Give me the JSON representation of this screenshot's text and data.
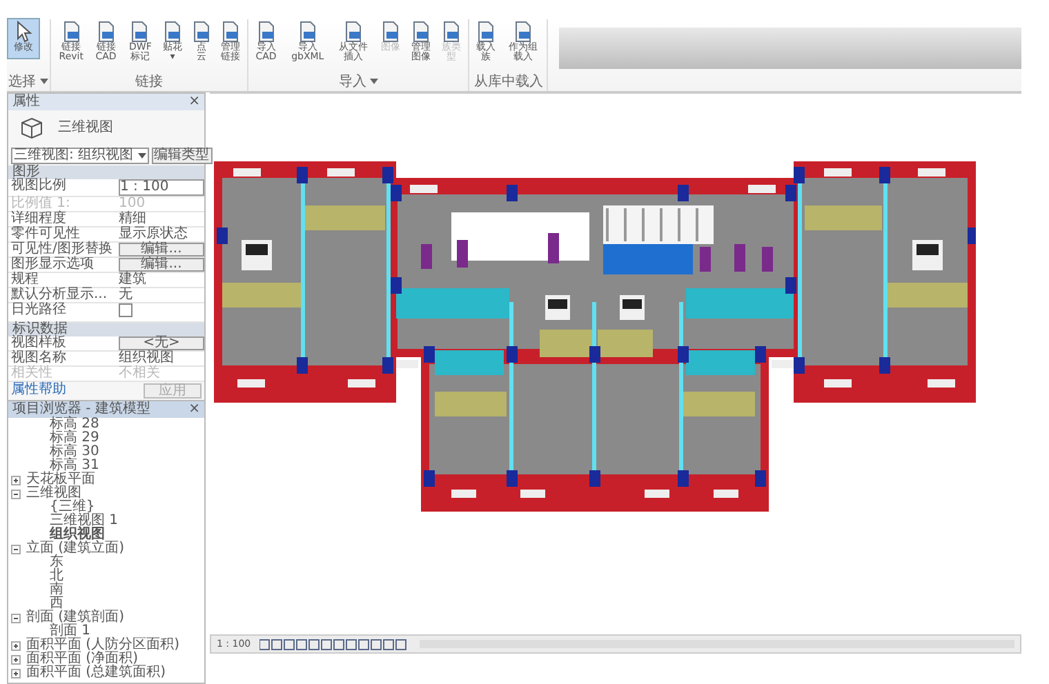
{
  "ribbon": {
    "panels": [
      {
        "title": "选择",
        "dropdown": true,
        "buttons": [
          {
            "kind": "pointer",
            "lines": [
              "修改"
            ],
            "selected": true,
            "disabled": false
          }
        ]
      },
      {
        "title": "链接",
        "dropdown": false,
        "buttons": [
          {
            "kind": "document",
            "lines": [
              "链接",
              "Revit"
            ],
            "selected": false,
            "disabled": false
          },
          {
            "kind": "document",
            "lines": [
              "链接",
              "CAD"
            ],
            "selected": false,
            "disabled": false
          },
          {
            "kind": "document",
            "lines": [
              "DWF",
              "标记"
            ],
            "selected": false,
            "disabled": false
          },
          {
            "kind": "document",
            "lines": [
              "贴花",
              "▾"
            ],
            "selected": false,
            "disabled": false
          },
          {
            "kind": "document",
            "lines": [
              "点",
              "云"
            ],
            "selected": false,
            "disabled": false
          },
          {
            "kind": "document",
            "lines": [
              "管理",
              "链接"
            ],
            "selected": false,
            "disabled": false
          }
        ]
      },
      {
        "title": "导入",
        "dropdown": true,
        "buttons": [
          {
            "kind": "document",
            "lines": [
              "导入",
              "CAD"
            ],
            "selected": false,
            "disabled": false
          },
          {
            "kind": "document",
            "lines": [
              "导入",
              "gbXML"
            ],
            "selected": false,
            "disabled": false
          },
          {
            "kind": "document",
            "lines": [
              "从文件",
              "插入"
            ],
            "selected": false,
            "disabled": false
          },
          {
            "kind": "document",
            "lines": [
              "图像"
            ],
            "selected": false,
            "disabled": true
          },
          {
            "kind": "document",
            "lines": [
              "管理",
              "图像"
            ],
            "selected": false,
            "disabled": false
          },
          {
            "kind": "document",
            "lines": [
              "族类",
              "型"
            ],
            "selected": false,
            "disabled": true
          }
        ]
      },
      {
        "title": "从库中载入",
        "dropdown": false,
        "buttons": [
          {
            "kind": "document",
            "lines": [
              "载入",
              "族"
            ],
            "selected": false,
            "disabled": false
          },
          {
            "kind": "document",
            "lines": [
              "作为组",
              "载入"
            ],
            "selected": false,
            "disabled": false
          }
        ]
      }
    ]
  },
  "properties": {
    "title": "属性",
    "close": "×",
    "type_name": "三维视图",
    "type_selector": "三维视图: 组织视图",
    "edit_type": "编辑类型",
    "groups": [
      {
        "title": "图形",
        "rows": [
          {
            "kind": "field",
            "label": "视图比例",
            "value": "1 : 100",
            "disabled": false
          },
          {
            "kind": "text",
            "label": "比例值 1:",
            "value": "100",
            "disabled": true
          },
          {
            "kind": "text",
            "label": "详细程度",
            "value": "精细",
            "disabled": false
          },
          {
            "kind": "text",
            "label": "零件可见性",
            "value": "显示原状态",
            "disabled": false
          },
          {
            "kind": "button",
            "label": "可见性/图形替换",
            "value": "编辑...",
            "disabled": false
          },
          {
            "kind": "button",
            "label": "图形显示选项",
            "value": "编辑...",
            "disabled": false
          },
          {
            "kind": "text",
            "label": "规程",
            "value": "建筑",
            "disabled": false
          },
          {
            "kind": "text",
            "label": "默认分析显示...",
            "value": "无",
            "disabled": false
          },
          {
            "kind": "checkbox",
            "label": "日光路径",
            "checked": false,
            "disabled": false
          }
        ]
      },
      {
        "title": "标识数据",
        "rows": [
          {
            "kind": "button",
            "label": "视图样板",
            "value": "<无>",
            "disabled": false
          },
          {
            "kind": "text",
            "label": "视图名称",
            "value": "组织视图",
            "disabled": false
          },
          {
            "kind": "text",
            "label": "相关性",
            "value": "不相关",
            "disabled": true
          }
        ]
      }
    ],
    "help_link": "属性帮助",
    "apply": "应用"
  },
  "project_browser": {
    "title": "项目浏览器 - 建筑模型",
    "close": "×",
    "continued": [
      "标高 28",
      "标高 29",
      "标高 30",
      "标高 31"
    ],
    "nodes": [
      {
        "label": "天花板平面",
        "expanded": false
      },
      {
        "label": "三维视图",
        "expanded": true,
        "children": [
          {
            "label": "{三维}",
            "selected": false
          },
          {
            "label": "三维视图 1",
            "selected": false
          },
          {
            "label": "组织视图",
            "selected": true
          }
        ]
      },
      {
        "label": "立面 (建筑立面)",
        "expanded": true,
        "children": [
          {
            "label": "东",
            "selected": false
          },
          {
            "label": "北",
            "selected": false
          },
          {
            "label": "南",
            "selected": false
          },
          {
            "label": "西",
            "selected": false
          }
        ]
      },
      {
        "label": "剖面 (建筑剖面)",
        "expanded": true,
        "children": [
          {
            "label": "剖面 1",
            "selected": false
          }
        ]
      },
      {
        "label": "面积平面 (人防分区面积)",
        "expanded": false
      },
      {
        "label": "面积平面 (净面积)",
        "expanded": false
      },
      {
        "label": "面积平面 (总建筑面积)",
        "expanded": false
      }
    ]
  },
  "view_bar": {
    "scale": "1 : 100"
  }
}
